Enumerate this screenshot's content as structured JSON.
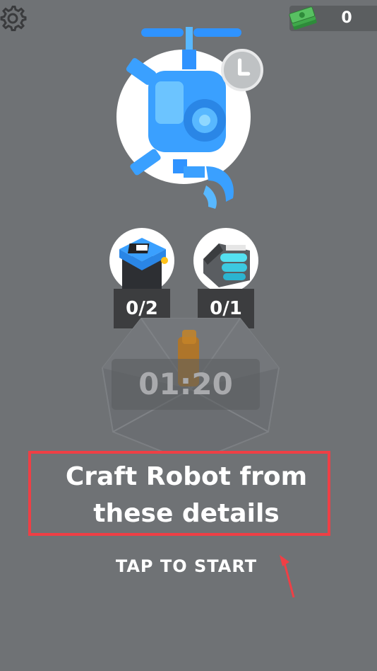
{
  "hud": {
    "money": "0",
    "settings_icon": "gear-icon",
    "money_icon": "cash-stack-icon"
  },
  "recipe": {
    "robot_icon": "drone-robot-icon",
    "timer_badge_icon": "clock-icon",
    "parts": [
      {
        "icon": "robot-head-part-icon",
        "count": "0/2"
      },
      {
        "icon": "battery-part-icon",
        "count": "0/1"
      }
    ]
  },
  "timer": "01:20",
  "message": {
    "line1": "Craft Robot from",
    "line2": "these details"
  },
  "tap_to_start": "TAP TO START",
  "colors": {
    "background": "#6f7275",
    "robot_blue": "#3aa0ff",
    "highlight": "#ef3f45"
  }
}
